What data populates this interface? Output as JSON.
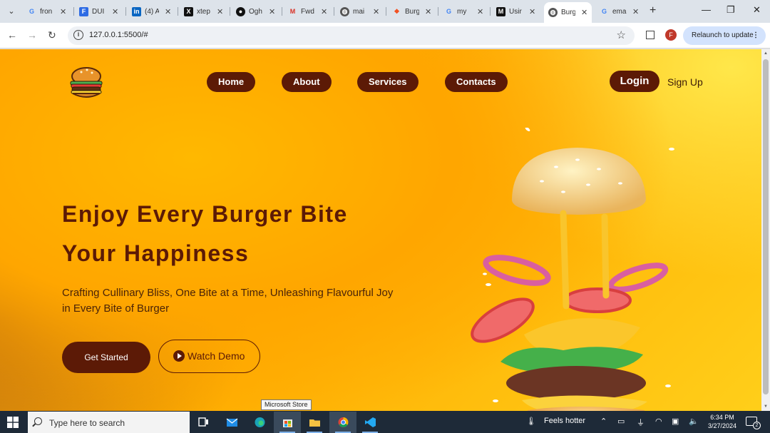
{
  "browser": {
    "tabs": [
      {
        "title": "fron",
        "icon": "google-icon"
      },
      {
        "title": "DUI",
        "icon": "doc-icon"
      },
      {
        "title": "(4) A",
        "icon": "linkedin-icon"
      },
      {
        "title": "xtep",
        "icon": "x-icon"
      },
      {
        "title": "Ogh",
        "icon": "github-icon"
      },
      {
        "title": "Fwd",
        "icon": "gmail-icon"
      },
      {
        "title": "mai",
        "icon": "globe-icon"
      },
      {
        "title": "Burg",
        "icon": "figma-icon"
      },
      {
        "title": "my",
        "icon": "google-icon"
      },
      {
        "title": "Usir",
        "icon": "medium-icon"
      },
      {
        "title": "Burg",
        "icon": "globe-icon",
        "active": true
      },
      {
        "title": "ema",
        "icon": "google-icon"
      }
    ],
    "close_glyph": "✕",
    "new_tab_glyph": "+",
    "url": "127.0.0.1:5500/#",
    "profile_initial": "F",
    "relaunch_label": "Relaunch to update",
    "window_controls": {
      "minimize": "—",
      "restore": "❐",
      "close": "✕"
    }
  },
  "page": {
    "nav": {
      "home": "Home",
      "about": "About",
      "services": "Services",
      "contacts": "Contacts",
      "login": "Login",
      "signup": "Sign Up"
    },
    "hero": {
      "headline_line1": "Enjoy Every Burger Bite",
      "headline_line2": "Your Happiness",
      "subtext": "Crafting Cullinary Bliss, One Bite at a Time, Unleashing Flavourful Joy in Every Bite of Burger",
      "cta_primary": "Get Started",
      "cta_secondary": "Watch Demo"
    },
    "colors": {
      "brand_dark": "#5c1a06",
      "background_orange": "#ffac00"
    }
  },
  "tooltip": "Microsoft Store",
  "taskbar": {
    "search_placeholder": "Type here to search",
    "apps": [
      "task-view-icon",
      "mail-icon",
      "edge-icon",
      "store-icon",
      "file-explorer-icon",
      "chrome-icon",
      "vscode-icon"
    ],
    "weather_label": "Feels hotter",
    "time": "6:34 PM",
    "date": "3/27/2024",
    "notification_count": "2"
  }
}
